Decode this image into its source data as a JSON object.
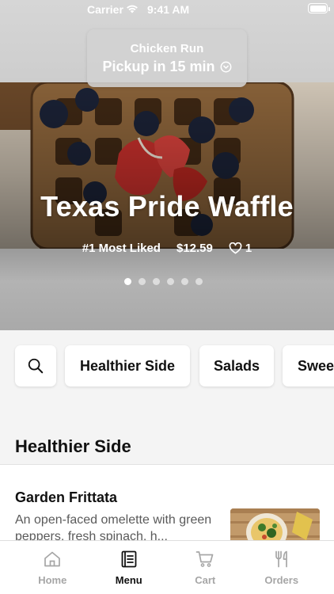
{
  "status_bar": {
    "carrier": "Carrier",
    "time": "9:41 AM"
  },
  "store": {
    "name": "Chicken Run",
    "pickup": "Pickup in 15 min"
  },
  "hero": {
    "title": "Texas Pride Waffle",
    "rank": "#1 Most Liked",
    "price": "$12.59",
    "likes": "1",
    "slides": 6,
    "active_slide": 1
  },
  "categories": {
    "search_icon": "search-icon",
    "items": [
      "Healthier Side",
      "Salads",
      "Sweets"
    ]
  },
  "section": {
    "title": "Healthier Side"
  },
  "menu_item": {
    "name": "Garden Frittata",
    "description": "An open-faced omelette with green peppers, fresh spinach, h..."
  },
  "tabs": [
    {
      "label": "Home",
      "icon": "home-icon",
      "active": false
    },
    {
      "label": "Menu",
      "icon": "menu-book-icon",
      "active": true
    },
    {
      "label": "Cart",
      "icon": "cart-icon",
      "active": false
    },
    {
      "label": "Orders",
      "icon": "utensils-icon",
      "active": false
    }
  ],
  "colors": {
    "active_tab": "#111111",
    "inactive_tab": "#a6a6a6",
    "background": "#f4f4f4"
  }
}
